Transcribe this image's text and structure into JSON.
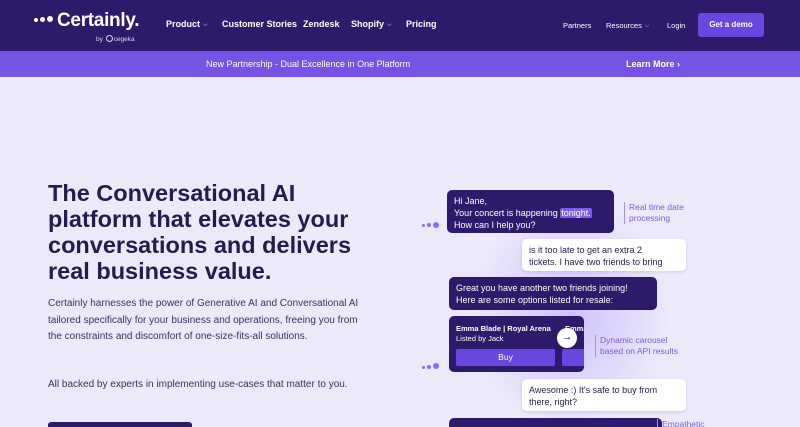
{
  "nav": {
    "brand": "Certainly.",
    "brand_sub_prefix": "by",
    "brand_sub_name": "cegeka",
    "links": {
      "product": "Product",
      "customer_stories": "Customer Stories",
      "zendesk": "Zendesk",
      "shopify": "Shopify",
      "pricing": "Pricing",
      "partners": "Partners",
      "resources": "Resources",
      "login": "Login"
    },
    "cta": "Get a demo"
  },
  "banner": {
    "text": "New Partnership - Dual Excellence in One Platform",
    "link": "Learn More"
  },
  "hero": {
    "title": "The Conversational AI platform that elevates your conversations and delivers real business value.",
    "body": "Certainly harnesses the power of Generative AI and Conversational AI tailored specifically for your business and operations, freeing you from the constraints and discomfort of one-size-fits-all solutions.",
    "body2": "All backed by experts in implementing use-cases that matter to you."
  },
  "chat": {
    "msg1_line1": "Hi Jane,",
    "msg1_line2_pre": "Your concert is happening ",
    "msg1_line2_hl": "tonight.",
    "msg1_line3": "How can I help you?",
    "msg2_line1": "is it too late to get an extra 2",
    "msg2_line2": "tickets. I have two friends to bring",
    "msg3_line1": "Great you have another two friends joining!",
    "msg3_line2": "Here are some options listed for resale:",
    "card_title": "Emma Blade | Royal Arena",
    "card_sub": "Listed by Jack",
    "card2_title": "Emma",
    "buy_label": "Buy",
    "msg4_line1": "Awesome :) It's safe to buy from",
    "msg4_line2": "there, right?",
    "annot1_line1": "Real time date",
    "annot1_line2": "processing",
    "annot2_line1": "Dynamic carousel",
    "annot2_line2": "based on API results",
    "annot3_line1": "Empathetic"
  },
  "icons": {
    "chevron": "chevron-down-icon",
    "arrow": "chevron-right-icon"
  },
  "colors": {
    "nav_bg": "#2e1a6b",
    "banner_bg": "#7652e6",
    "page_bg": "#ece9fb",
    "accent": "#6a46e0",
    "heading": "#261a4f"
  }
}
